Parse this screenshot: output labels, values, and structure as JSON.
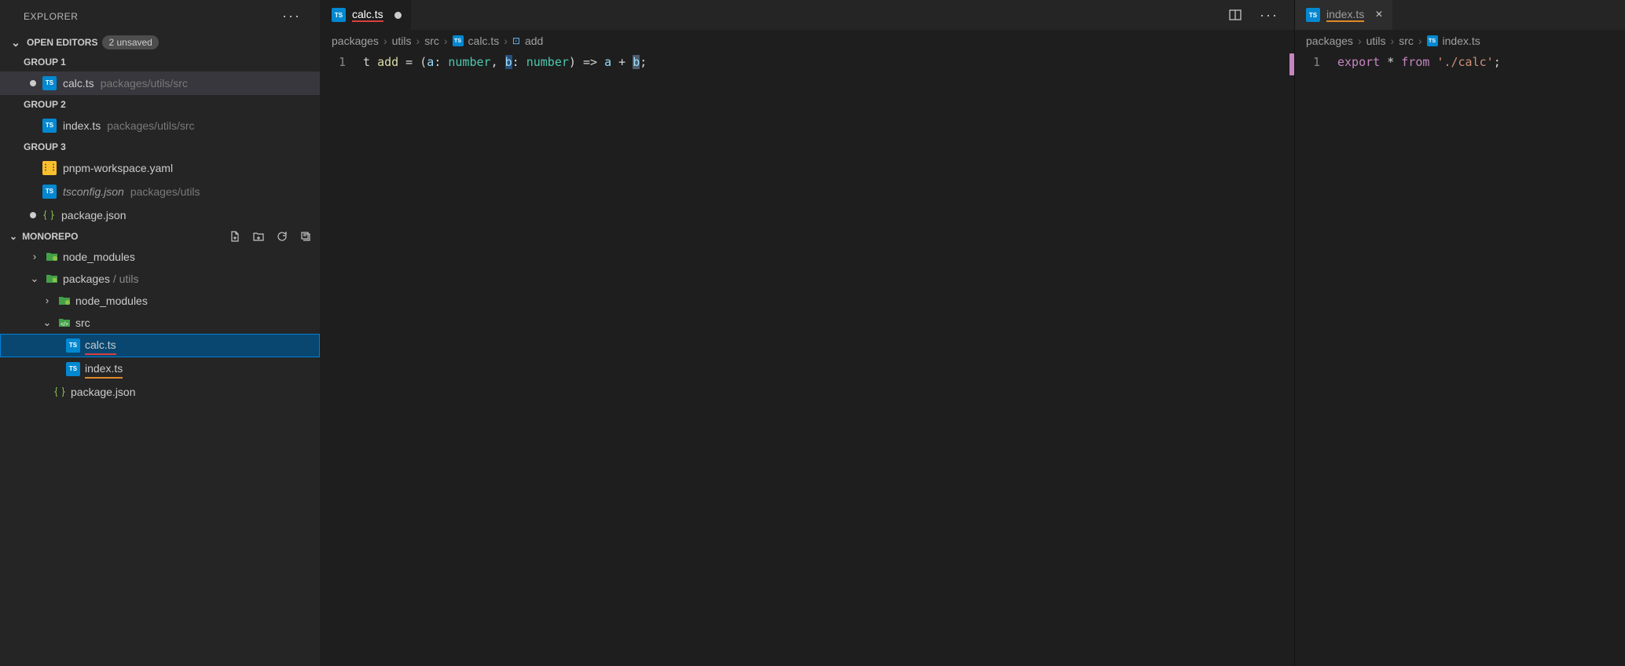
{
  "sidebar": {
    "title": "EXPLORER",
    "openEditors": {
      "label": "OPEN EDITORS",
      "badge": "2 unsaved",
      "groups": [
        {
          "label": "GROUP 1",
          "items": [
            {
              "dirty": true,
              "icon": "ts",
              "name": "calc.ts",
              "path": "packages/utils/src",
              "active": true
            }
          ]
        },
        {
          "label": "GROUP 2",
          "items": [
            {
              "dirty": false,
              "icon": "ts",
              "name": "index.ts",
              "path": "packages/utils/src"
            }
          ]
        },
        {
          "label": "GROUP 3",
          "items": [
            {
              "dirty": false,
              "icon": "yaml",
              "name": "pnpm-workspace.yaml",
              "path": ""
            },
            {
              "dirty": false,
              "icon": "tsconfig",
              "name": "tsconfig.json",
              "path": "packages/utils",
              "italic": true
            },
            {
              "dirty": true,
              "icon": "json",
              "name": "package.json",
              "path": ""
            }
          ]
        }
      ]
    },
    "workspace": {
      "label": "MONOREPO",
      "tree": [
        {
          "depth": 0,
          "chev": "right",
          "icon": "folder",
          "label": "node_modules"
        },
        {
          "depth": 0,
          "chev": "down",
          "icon": "folder",
          "label": "packages",
          "suffix": "/ utils"
        },
        {
          "depth": 1,
          "chev": "right",
          "icon": "folder",
          "label": "node_modules"
        },
        {
          "depth": 1,
          "chev": "down",
          "icon": "folder-src",
          "label": "src"
        },
        {
          "depth": 2,
          "chev": "",
          "icon": "ts",
          "label": "calc.ts",
          "selected": true,
          "underline": "red"
        },
        {
          "depth": 2,
          "chev": "",
          "icon": "ts",
          "label": "index.ts",
          "underline": "orange"
        },
        {
          "depth": 1,
          "chev": "",
          "icon": "json",
          "label": "package.json"
        }
      ]
    }
  },
  "editor1": {
    "tab": {
      "name": "calc.ts",
      "dirty": true,
      "underline": "red"
    },
    "breadcrumb": [
      "packages",
      "utils",
      "src",
      "calc.ts",
      "add"
    ],
    "lineNo": "1",
    "code": {
      "lead": "t ",
      "fn": "add",
      "eq": " = ",
      "lp": "(",
      "a": "a",
      "colon": ": ",
      "num": "number",
      "comma": ", ",
      "b": "b",
      "rp": ")",
      "arrow": " => ",
      "plus": " + ",
      "semi": ";"
    }
  },
  "editor2": {
    "tab": {
      "name": "index.ts",
      "underline": "orange"
    },
    "breadcrumb": [
      "packages",
      "utils",
      "src",
      "index.ts"
    ],
    "lineNo": "1",
    "code": {
      "export": "export",
      "star": " * ",
      "from": "from",
      "sp": " ",
      "str": "'./calc'",
      "semi": ";"
    }
  }
}
